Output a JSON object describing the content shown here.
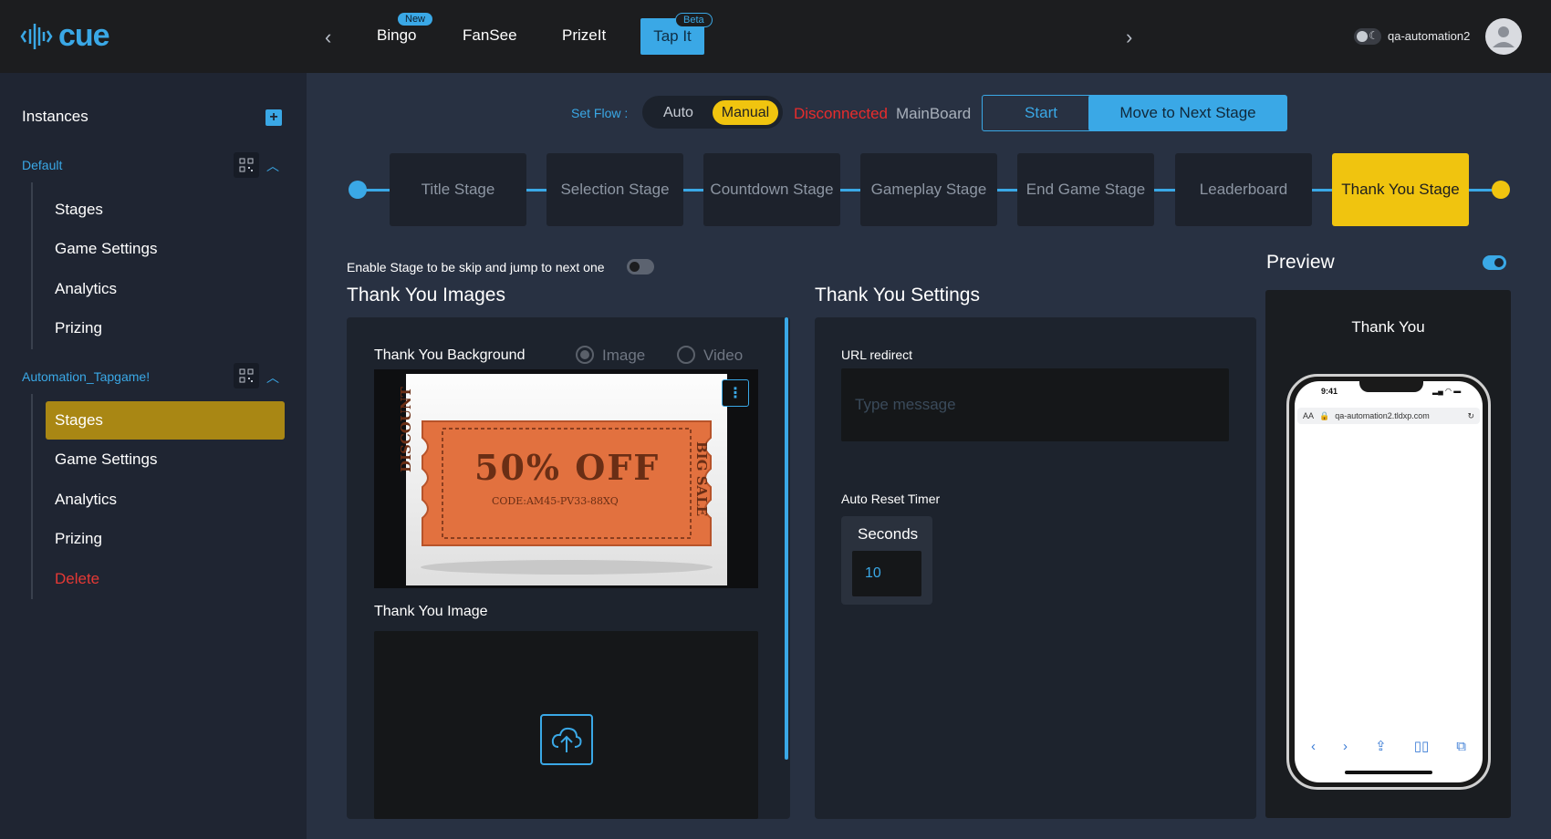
{
  "header": {
    "logo_text": "cue",
    "nav": [
      {
        "label": "Bingo",
        "badge": "New"
      },
      {
        "label": "FanSee",
        "badge": ""
      },
      {
        "label": "PrizeIt",
        "badge": ""
      },
      {
        "label": "Tap It",
        "badge": "Beta",
        "active": true
      }
    ],
    "username": "qa-automation2"
  },
  "sidebar": {
    "title": "Instances",
    "groups": [
      {
        "name": "Default",
        "items": [
          "Stages",
          "Game Settings",
          "Analytics",
          "Prizing"
        ]
      },
      {
        "name": "Automation_Tapgame!",
        "items": [
          "Stages",
          "Game Settings",
          "Analytics",
          "Prizing",
          "Delete"
        ],
        "active_item": "Stages"
      }
    ]
  },
  "flow": {
    "label": "Set Flow :",
    "auto": "Auto",
    "manual": "Manual",
    "selected": "Manual",
    "status": "Disconnected",
    "board": "MainBoard",
    "start": "Start",
    "next": "Move to Next Stage"
  },
  "stages": [
    "Title Stage",
    "Selection Stage",
    "Countdown Stage",
    "Gameplay Stage",
    "End Game Stage",
    "Leaderboard",
    "Thank You Stage"
  ],
  "active_stage": "Thank You Stage",
  "skip_label": "Enable Stage to be skip and jump to next one",
  "images": {
    "title": "Thank You Images",
    "background_label": "Thank You Background",
    "radio_image": "Image",
    "radio_video": "Video",
    "image_label": "Thank You Image",
    "ticket": {
      "main": "50% OFF",
      "code": "CODE:AM45-PV33-88XQ",
      "left": "DISCOUNT",
      "right": "BIG SALE"
    }
  },
  "settings": {
    "title": "Thank You Settings",
    "url_label": "URL redirect",
    "url_placeholder": "Type message",
    "timer_label": "Auto Reset Timer",
    "seconds_label": "Seconds",
    "seconds_value": "10"
  },
  "preview": {
    "title": "Preview",
    "thank_you": "Thank You",
    "time": "9:41",
    "url": "qa-automation2.tldxp.com",
    "aa": "AA"
  },
  "colors": {
    "accent": "#3aa8e6",
    "active_stage": "#f0c40f",
    "sidebar_active": "#a98714",
    "error": "#e82c2c"
  }
}
